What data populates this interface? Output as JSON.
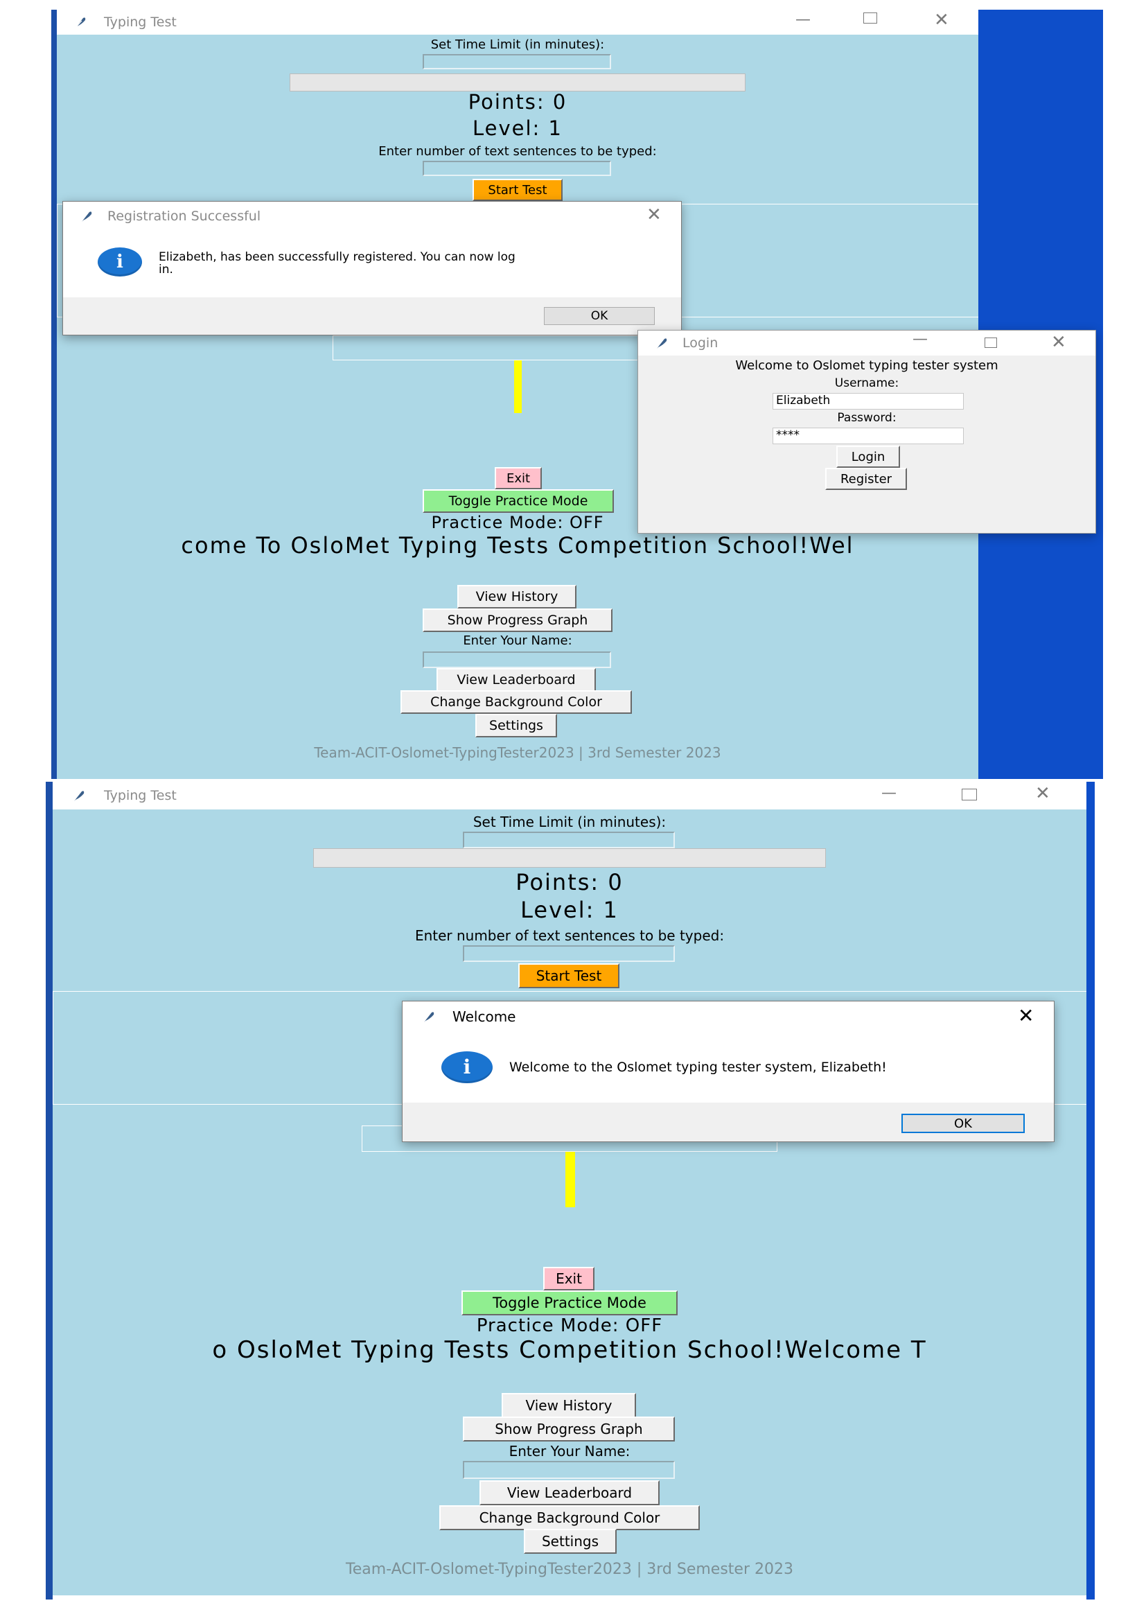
{
  "colors": {
    "client_bg": "#ADD8E6",
    "desktop_blue": "#0E4EC9",
    "start_button": "#FFA500",
    "exit_button": "#FFC0CB",
    "practice_button": "#90EE90",
    "progress_indicator": "#FFFF00",
    "info_icon": "#1A74D0"
  },
  "screenshot1": {
    "window_title": "Typing Test",
    "time_limit_label": "Set Time Limit (in minutes):",
    "points": "Points: 0",
    "level": "Level: 1",
    "sentences_label": "Enter number of text sentences to be typed:",
    "start_button": "Start Test",
    "exit_button": "Exit",
    "practice_toggle": "Toggle Practice Mode",
    "practice_status": "Practice Mode: OFF",
    "marquee": "come To OsloMet Typing Tests Competition School!Wel",
    "view_history": "View History",
    "progress_graph": "Show Progress Graph",
    "name_label": "Enter Your Name:",
    "leaderboard": "View Leaderboard",
    "bg_color": "Change Background Color",
    "settings": "Settings",
    "footer": "Team-ACIT-Oslomet-TypingTester2023 | 3rd Semester 2023",
    "registration_dialog": {
      "title": "Registration Successful",
      "message_line1": "Elizabeth, has been successfully registered. You can now log",
      "message_line2": "in.",
      "ok": "OK"
    },
    "login_window": {
      "title": "Login",
      "welcome": "Welcome to Oslomet typing tester system",
      "username_label": "Username:",
      "username_value": "Elizabeth",
      "password_label": "Password:",
      "password_value": "****",
      "login_button": "Login",
      "register_button": "Register"
    }
  },
  "screenshot2": {
    "window_title": "Typing Test",
    "time_limit_label": "Set Time Limit (in minutes):",
    "points": "Points: 0",
    "level": "Level: 1",
    "sentences_label": "Enter number of text sentences to be typed:",
    "start_button": "Start Test",
    "exit_button": "Exit",
    "practice_toggle": "Toggle Practice Mode",
    "practice_status": "Practice Mode: OFF",
    "marquee": "o OsloMet Typing Tests Competition School!Welcome T",
    "view_history": "View History",
    "progress_graph": "Show Progress Graph",
    "name_label": "Enter Your Name:",
    "leaderboard": "View Leaderboard",
    "bg_color": "Change Background Color",
    "settings": "Settings",
    "footer": "Team-ACIT-Oslomet-TypingTester2023 | 3rd Semester 2023",
    "welcome_dialog": {
      "title": "Welcome",
      "message": "Welcome to the Oslomet typing tester system, Elizabeth!",
      "ok": "OK"
    }
  }
}
